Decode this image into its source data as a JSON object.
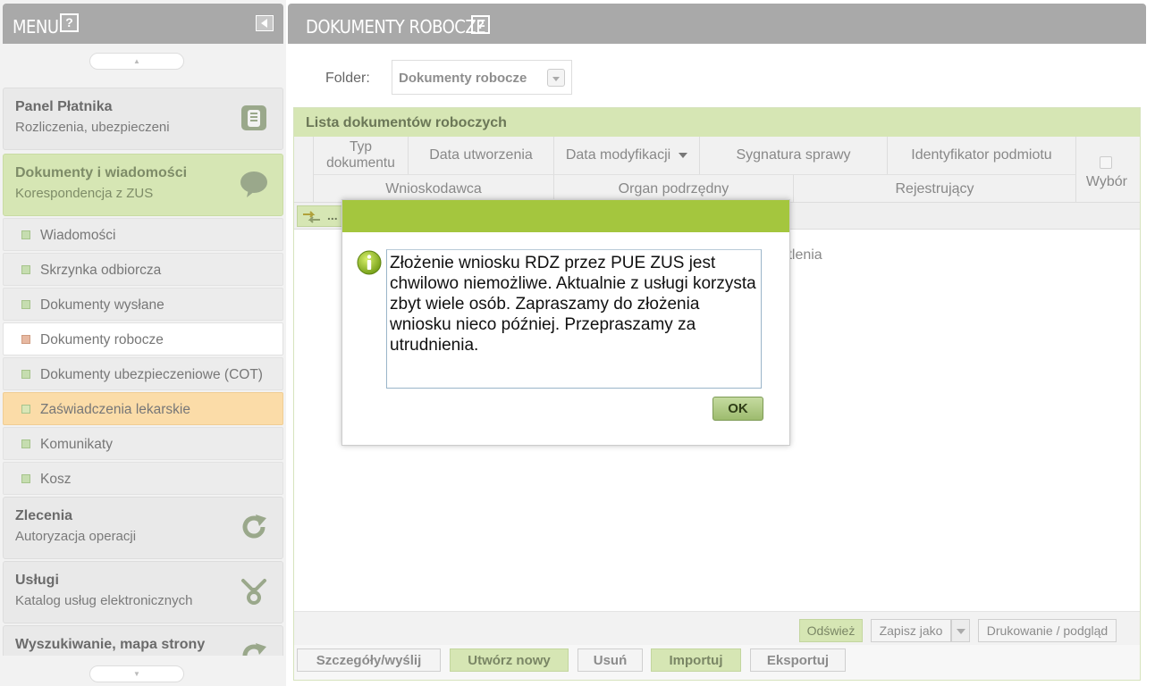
{
  "colors": {
    "header_grey": "#a9a9a9",
    "green_light": "#d6e6b4",
    "green_accent": "#a4c63e",
    "highlight_orange": "#fbdca8"
  },
  "sidebar": {
    "title": "MENU",
    "help_label": "?",
    "sections": [
      {
        "title": "Panel Płatnika",
        "subtitle": "Rozliczenia, ubezpieczeni",
        "icon": "folder-icon"
      },
      {
        "title": "Dokumenty i wiadomości",
        "subtitle": "Korespondencja z ZUS",
        "icon": "speech-bubble-icon"
      },
      {
        "title": "Zlecenia",
        "subtitle": "Autoryzacja operacji",
        "icon": "refresh-icon"
      },
      {
        "title": "Usługi",
        "subtitle": "Katalog usług elektronicznych",
        "icon": "services-icon"
      },
      {
        "title": "Wyszukiwanie, mapa strony",
        "subtitle": "",
        "icon": "refresh-icon"
      }
    ],
    "items": [
      {
        "label": "Wiadomości"
      },
      {
        "label": "Skrzynka odbiorcza"
      },
      {
        "label": "Dokumenty wysłane"
      },
      {
        "label": "Dokumenty robocze"
      },
      {
        "label": "Dokumenty ubezpieczeniowe (COT)"
      },
      {
        "label": "Zaświadczenia lekarskie"
      },
      {
        "label": "Komunikaty"
      },
      {
        "label": "Kosz"
      }
    ],
    "scroll_up": "▲",
    "scroll_down": "▼"
  },
  "main": {
    "title": "DOKUMENTY ROBOCZE",
    "help_label": "?",
    "folder_label": "Folder:",
    "folder_value": "Dokumenty robocze",
    "list_title": "Lista dokumentów roboczych",
    "columns": {
      "typ": "Typ dokumentu",
      "data_utworzenia": "Data utworzenia",
      "data_modyfikacji": "Data modyfikacji",
      "sygnatura": "Sygnatura sprawy",
      "identyfikator": "Identyfikator podmiotu",
      "wybor": "Wybór",
      "wnioskodawca": "Wnioskodawca",
      "organ": "Organ podrzędny",
      "rejestrujacy": "Rejestrujący"
    },
    "filter_dots": "...",
    "empty_tail": "ietlenia",
    "grid_buttons": {
      "refresh": "Odśwież",
      "save_as": "Zapisz jako",
      "print": "Drukowanie / podgląd"
    },
    "actions": {
      "details": "Szczegóły/wyślij",
      "create": "Utwórz nowy",
      "delete": "Usuń",
      "import": "Importuj",
      "export": "Eksportuj"
    }
  },
  "modal": {
    "message": "Złożenie wniosku RDZ przez PUE ZUS jest chwilowo niemożliwe. Aktualnie z usługi korzysta zbyt wiele osób. Zapraszamy do złożenia wniosku nieco później. Przepraszamy za utrudnienia.",
    "ok_label": "OK"
  }
}
